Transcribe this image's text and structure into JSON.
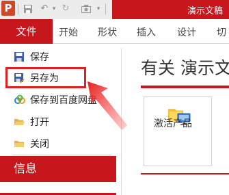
{
  "window": {
    "title": "演示文稿"
  },
  "ribbon": {
    "file_tab": "文件",
    "tabs": [
      "开始",
      "形状",
      "插入",
      "设计",
      "切"
    ]
  },
  "nav": {
    "items": [
      {
        "label": "保存",
        "icon": "save-icon"
      },
      {
        "label": "另存为",
        "icon": "save-as-icon"
      },
      {
        "label": "保存到百度网盘",
        "icon": "baidu-cloud-icon"
      },
      {
        "label": "打开",
        "icon": "open-folder-icon"
      },
      {
        "label": "关闭",
        "icon": "close-folder-icon"
      }
    ],
    "info_tab": "信息"
  },
  "content": {
    "title": "有关 演示文",
    "activate_label": "激活产品"
  },
  "colors": {
    "accent": "#c8161d",
    "highlight": "#e02020"
  }
}
